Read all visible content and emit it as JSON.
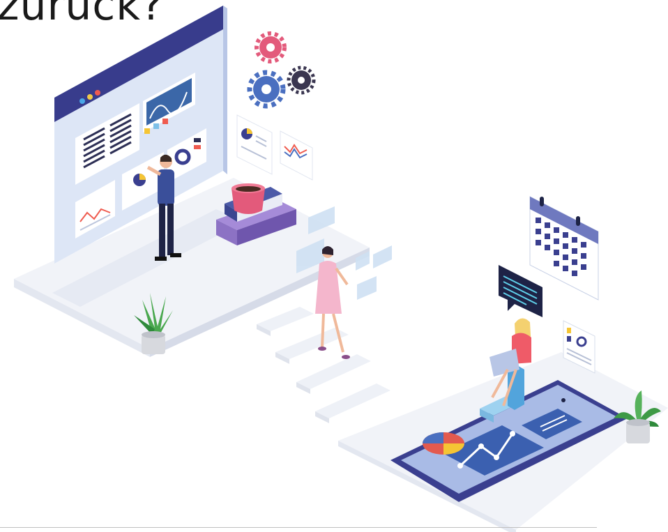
{
  "heading": {
    "text": "zurück?"
  },
  "colors": {
    "primary": "#3a3f8f",
    "accent_blue": "#4a6fc0",
    "light_panel": "#e4ecf8",
    "pink": "#e8507a",
    "coral": "#f05a4f",
    "yellow": "#f5c534",
    "purple": "#8a79c9",
    "green": "#4aa84f",
    "platform": "#f2f4f9"
  },
  "illustration": {
    "icons": [
      "browser-window-icon",
      "gears-icon",
      "coffee-cup-icon",
      "books-icon",
      "calendar-icon",
      "chat-bubble-icon",
      "tablet-icon",
      "plant-icon",
      "pie-chart-icon",
      "line-chart-icon"
    ]
  }
}
